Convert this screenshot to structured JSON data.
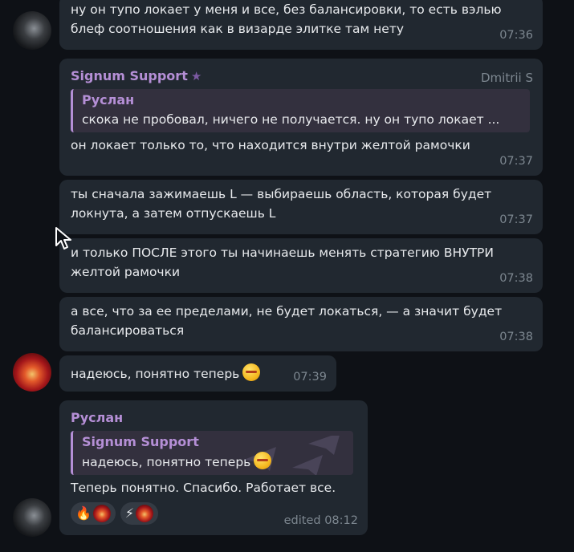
{
  "messages": {
    "m1": {
      "line1": "ну он тупо локает у меня и все, без балансировки, то есть вэлью",
      "line2": "блеф соотношения как в визарде элитке там нету",
      "time": "07:36"
    },
    "m2": {
      "sender": "Signum Support",
      "rank": "Dmitrii S",
      "quote_name": "Руслан",
      "quote_text": "скока не пробовал, ничего не получается. ну он тупо локает ...",
      "text": "он локает только то, что находится внутри желтой рамочки",
      "time": "07:37"
    },
    "m3": {
      "line1": "ты сначала зажимаешь L — выбираешь область, которая будет",
      "line2": "локнута, а затем отпускаешь L",
      "time": "07:37"
    },
    "m4": {
      "line1": "и только ПОСЛЕ этого ты начинаешь менять стратегию ВНУТРИ",
      "line2": "желтой рамочки",
      "time": "07:38"
    },
    "m5": {
      "line1": "а все, что за ее пределами, не будет локаться, — а значит будет",
      "line2": "балансироваться",
      "time": "07:38"
    },
    "m6": {
      "text": "надеюсь, понятно теперь",
      "time": "07:39"
    },
    "m7": {
      "sender": "Руслан",
      "quote_name": "Signum Support",
      "quote_text": "надеюсь, понятно теперь",
      "text": "Теперь понятно. Спасибо. Работает все.",
      "time": "edited 08:12",
      "reactions": [
        {
          "glyph": "🔥"
        },
        {
          "glyph": "⚡"
        }
      ]
    }
  },
  "icons": {
    "star": "star-icon",
    "emoji": "confounded-face-emoji",
    "cursor": "mouse-pointer-icon"
  },
  "colors": {
    "background": "#0e1116",
    "bubble": "#212830",
    "accent_name": "#b58fd6",
    "quote_bg": "#33303e",
    "time": "#7d8790"
  }
}
